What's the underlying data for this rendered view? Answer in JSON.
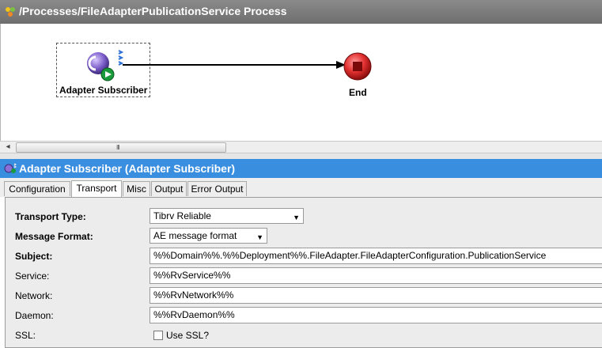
{
  "process": {
    "title": "/Processes/FileAdapterPublicationService Process"
  },
  "canvas": {
    "nodes": [
      {
        "label": "Adapter Subscriber"
      },
      {
        "label": "End"
      }
    ]
  },
  "scrollbar": {
    "left_arrow": "◂",
    "grip": "III"
  },
  "activity": {
    "title": "Adapter Subscriber (Adapter Subscriber)"
  },
  "tabs": [
    {
      "label": "Configuration"
    },
    {
      "label": "Transport",
      "active": true
    },
    {
      "label": "Misc"
    },
    {
      "label": "Output"
    },
    {
      "label": "Error Output"
    }
  ],
  "form": {
    "transport_type": {
      "label": "Transport Type:",
      "value": "Tibrv Reliable"
    },
    "message_format": {
      "label": "Message Format:",
      "value": "AE message format"
    },
    "subject": {
      "label": "Subject:",
      "value": "%%Domain%%.%%Deployment%%.FileAdapter.FileAdapterConfiguration.PublicationService"
    },
    "service": {
      "label": "Service:",
      "value": "%%RvService%%"
    },
    "network": {
      "label": "Network:",
      "value": "%%RvNetwork%%"
    },
    "daemon": {
      "label": "Daemon:",
      "value": "%%RvDaemon%%"
    },
    "ssl": {
      "label": "SSL:",
      "checkbox_label": "Use SSL?",
      "checked": false
    }
  },
  "colors": {
    "accent": "#3a8ee0",
    "header_gray": "#7a7a7a",
    "end_red": "#e23030"
  }
}
